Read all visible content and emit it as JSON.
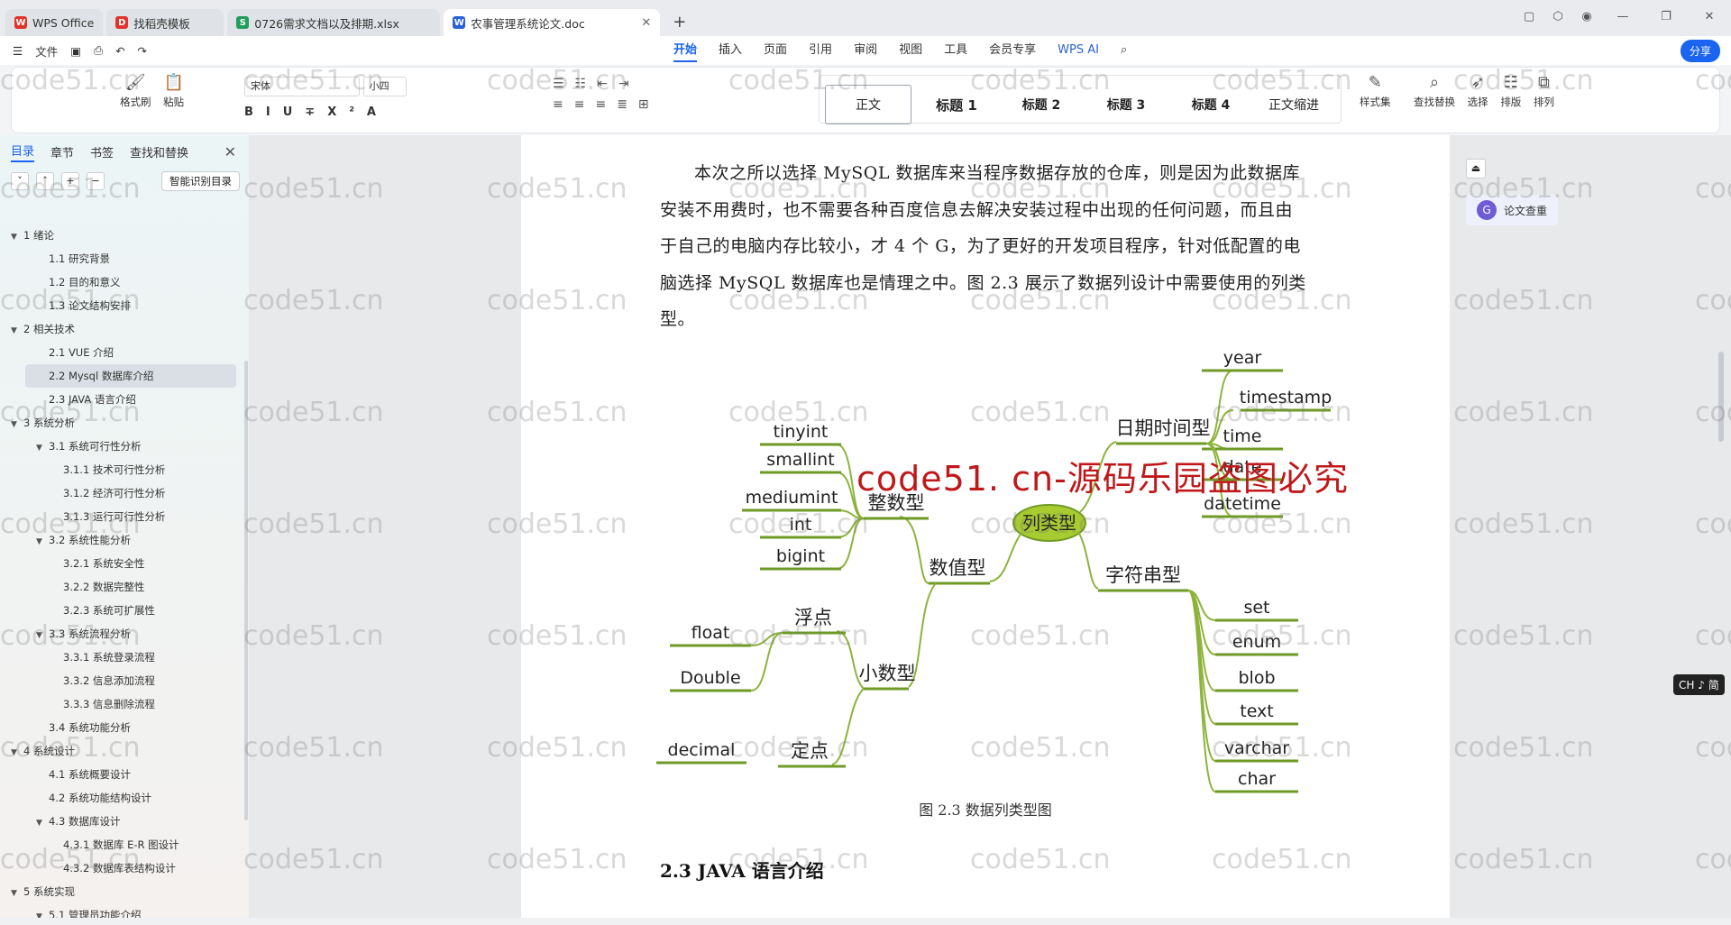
{
  "tabs": [
    {
      "label": "WPS Office",
      "icon": "wps-icon",
      "color": "#e0332a"
    },
    {
      "label": "找稻壳模板",
      "icon": "docer-icon",
      "color": "#e0332a"
    },
    {
      "label": "0726需求文档以及排期.xlsx",
      "icon": "sheet-icon",
      "color": "#1e9e5a"
    },
    {
      "label": "农事管理系统论文.doc",
      "icon": "word-icon",
      "color": "#2a62d6"
    }
  ],
  "menu": {
    "file": "文件",
    "ribbon_tabs": [
      "开始",
      "插入",
      "页面",
      "引用",
      "审阅",
      "视图",
      "工具",
      "会员专享"
    ],
    "wps_ai": "WPS AI",
    "share": "分享"
  },
  "ribbon": {
    "format_painter": "格式刷",
    "paste": "粘贴",
    "font": "宋体",
    "size": "小四",
    "styles": [
      "正文",
      "标题 1",
      "标题 2",
      "标题 3",
      "标题 4",
      "正文缩进"
    ],
    "style_set": "样式集",
    "find_replace": "查找替换",
    "select": "选择",
    "arrange": "排版",
    "order": "排列"
  },
  "left_panel": {
    "tabs": [
      "目录",
      "章节",
      "书签",
      "查找和替换"
    ],
    "smart_toc": "智能识别目录",
    "toc": [
      {
        "t": "1 绪论",
        "lvl": 1
      },
      {
        "t": "1.1 研究背景",
        "lvl": 2
      },
      {
        "t": "1.2 目的和意义",
        "lvl": 2
      },
      {
        "t": "1.3 论文结构安排",
        "lvl": 2
      },
      {
        "t": "2 相关技术",
        "lvl": 1
      },
      {
        "t": "2.1 VUE 介绍",
        "lvl": 2
      },
      {
        "t": "2.2 Mysql 数据库介绍",
        "lvl": 2,
        "sel": true
      },
      {
        "t": "2.3 JAVA 语言介绍",
        "lvl": 2
      },
      {
        "t": "3 系统分析",
        "lvl": 1
      },
      {
        "t": "3.1 系统可行性分析",
        "lvl": 2,
        "exp": true
      },
      {
        "t": "3.1.1 技术可行性分析",
        "lvl": 3
      },
      {
        "t": "3.1.2 经济可行性分析",
        "lvl": 3
      },
      {
        "t": "3.1.3 运行可行性分析",
        "lvl": 3
      },
      {
        "t": "3.2 系统性能分析",
        "lvl": 2,
        "exp": true
      },
      {
        "t": "3.2.1 系统安全性",
        "lvl": 3
      },
      {
        "t": "3.2.2 数据完整性",
        "lvl": 3
      },
      {
        "t": "3.2.3 系统可扩展性",
        "lvl": 3
      },
      {
        "t": "3.3 系统流程分析",
        "lvl": 2,
        "exp": true
      },
      {
        "t": "3.3.1 系统登录流程",
        "lvl": 3
      },
      {
        "t": "3.3.2 信息添加流程",
        "lvl": 3
      },
      {
        "t": "3.3.3 信息删除流程",
        "lvl": 3
      },
      {
        "t": "3.4 系统功能分析",
        "lvl": 2
      },
      {
        "t": "4 系统设计",
        "lvl": 1
      },
      {
        "t": "4.1 系统概要设计",
        "lvl": 2
      },
      {
        "t": "4.2 系统功能结构设计",
        "lvl": 2
      },
      {
        "t": "4.3 数据库设计",
        "lvl": 2,
        "exp": true
      },
      {
        "t": "4.3.1 数据库 E-R 图设计",
        "lvl": 3
      },
      {
        "t": "4.3.2 数据库表结构设计",
        "lvl": 3
      },
      {
        "t": "5 系统实现",
        "lvl": 1
      },
      {
        "t": "5.1 管理员功能介绍",
        "lvl": 2,
        "exp": true
      }
    ]
  },
  "document": {
    "paragraph": "本次之所以选择 MySQL 数据库来当程序数据存放的仓库，则是因为此数据库安装不用费时，也不需要各种百度信息去解决安装过程中出现的任何问题，而且由于自己的电脑内存比较小，才 4 个 G，为了更好的开发项目程序，针对低配置的电脑选择 MySQL 数据库也是情理之中。图 2.3 展示了数据列设计中需要使用的列类型。",
    "mindmap": {
      "center": "列类型",
      "numeric": "数值型",
      "integer": "整数型",
      "float_group": "浮点",
      "decimal_group": "小数型",
      "fixed": "定点",
      "datetime": "日期时间型",
      "string": "字符串型",
      "int_types": [
        "tinyint",
        "smallint",
        "mediumint",
        "int",
        "bigint"
      ],
      "float_types": [
        "float",
        "Double"
      ],
      "fixed_types": [
        "decimal"
      ],
      "date_types": [
        "year",
        "timestamp",
        "time",
        "date",
        "datetime"
      ],
      "string_types": [
        "set",
        "enum",
        "blob",
        "text",
        "varchar",
        "char"
      ]
    },
    "caption": "图 2.3 数据列类型图",
    "heading": "2.3 JAVA 语言介绍",
    "watermark_red": "code51. cn-源码乐园盗图必究",
    "watermark": "code51.cn"
  },
  "right_panel": {
    "plagiarism": "论文查重"
  },
  "ime": "CH ♪ 简"
}
